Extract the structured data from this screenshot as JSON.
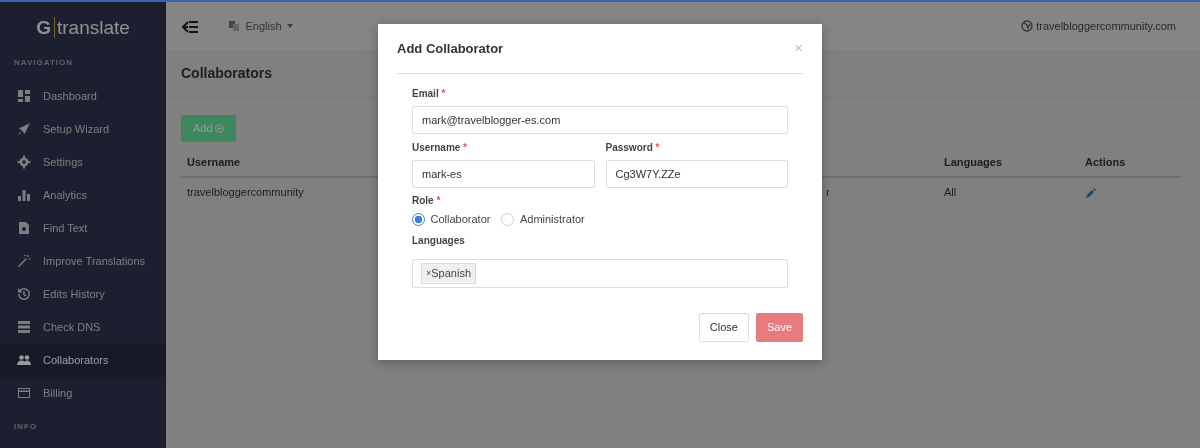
{
  "sidebar": {
    "logo": {
      "letter": "G",
      "word": "translate"
    },
    "nav_heading": "NAVIGATION",
    "items": [
      {
        "label": "Dashboard",
        "kind": "dashboard",
        "selected": false
      },
      {
        "label": "Setup Wizard",
        "kind": "rocket",
        "selected": false
      },
      {
        "label": "Settings",
        "kind": "gear",
        "selected": false
      },
      {
        "label": "Analytics",
        "kind": "bars",
        "selected": false
      },
      {
        "label": "Find Text",
        "kind": "file",
        "selected": false
      },
      {
        "label": "Improve Translations",
        "kind": "wand",
        "selected": false
      },
      {
        "label": "Edits History",
        "kind": "history",
        "selected": false
      },
      {
        "label": "Check DNS",
        "kind": "server",
        "selected": false
      },
      {
        "label": "Collaborators",
        "kind": "users",
        "selected": true
      },
      {
        "label": "Billing",
        "kind": "card",
        "selected": false
      }
    ],
    "info_heading": "INFO"
  },
  "topbar": {
    "language": "English",
    "site": "travelbloggercommunity.com"
  },
  "page": {
    "title": "Collaborators",
    "add_button": "Add"
  },
  "table": {
    "columns": [
      "Username",
      "Languages",
      "Actions"
    ],
    "rows": [
      {
        "username": "travelbloggercommunity",
        "column_2": "r",
        "languages": "All"
      }
    ]
  },
  "modal": {
    "title": "Add Collaborator",
    "close_symbol": "×",
    "email": {
      "label": "Email",
      "required_mark": "*",
      "value": "mark@travelblogger-es.com"
    },
    "username": {
      "label": "Username",
      "required_mark": "*",
      "value": "mark-es"
    },
    "password": {
      "label": "Password",
      "required_mark": "*",
      "value": "Cg3W7Y.ZZe"
    },
    "role": {
      "label": "Role",
      "required_mark": "*",
      "options": [
        {
          "label": "Collaborator",
          "selected": true
        },
        {
          "label": "Administrator",
          "selected": false
        }
      ]
    },
    "languages": {
      "label": "Languages",
      "tags": [
        {
          "remove": "×",
          "label": "Spanish"
        }
      ]
    },
    "close_button": "Close",
    "save_button": "Save"
  }
}
